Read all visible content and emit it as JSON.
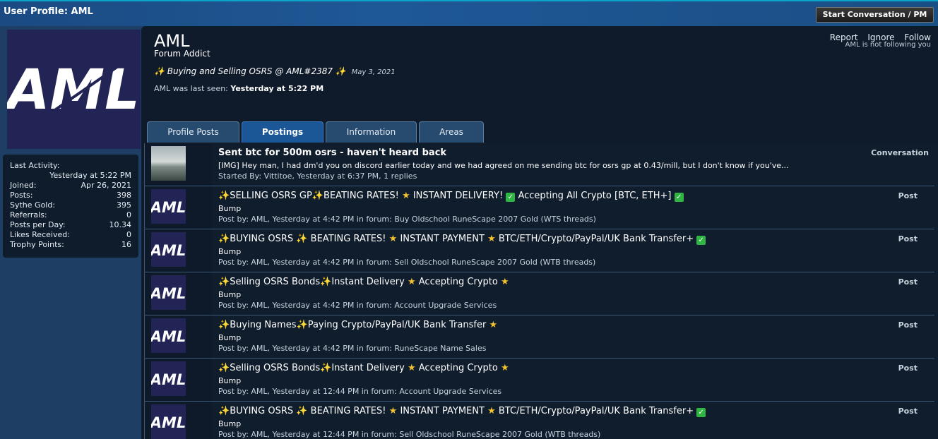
{
  "topbar": {
    "title": "User Profile: AML",
    "start_button": "Start Conversation / PM"
  },
  "avatar": {
    "letters": "AML"
  },
  "stats": [
    {
      "label": "Last Activity:",
      "value": "Yesterday at 5:22 PM",
      "block": true
    },
    {
      "label": "Joined:",
      "value": "Apr 26, 2021"
    },
    {
      "label": "Posts:",
      "value": "398"
    },
    {
      "label": "Sythe Gold:",
      "value": "395"
    },
    {
      "label": "Referrals:",
      "value": "0"
    },
    {
      "label": "Posts per Day:",
      "value": "10.34"
    },
    {
      "label": "Likes Received:",
      "value": "0"
    },
    {
      "label": "Trophy Points:",
      "value": "16"
    }
  ],
  "profile": {
    "name": "AML",
    "title": "Forum Addict",
    "status": "Buying and Selling OSRS @ AML#2387",
    "status_date": "May 3, 2021",
    "last_seen_prefix": "AML was last seen:",
    "last_seen_value": "Yesterday at 5:22 PM"
  },
  "actions": {
    "report": "Report",
    "ignore": "Ignore",
    "follow": "Follow",
    "follow_note": "AML is not following you"
  },
  "tabs": [
    {
      "label": "Profile Posts",
      "active": false
    },
    {
      "label": "Postings",
      "active": true
    },
    {
      "label": "Information",
      "active": false
    },
    {
      "label": "Areas",
      "active": false
    }
  ],
  "icons": {
    "sparkle": "sparkle-icon",
    "star": "star-icon",
    "check": "check-icon"
  },
  "colors": {
    "accent": "#1b5796",
    "star": "#f4c12f",
    "check": "#30b443"
  },
  "items": [
    {
      "kind": "Conversation",
      "thumb": "photo",
      "title": "Sent btc for 500m osrs - haven't heard back",
      "snippet": "[IMG] Hey man, I had dm'd you on discord earlier today and we had agreed on me sending btc for osrs gp at 0.43/mill, but I don't know if you've...",
      "meta": "Started By: Vittitoe, Yesterday at 6:37 PM, 1 replies"
    },
    {
      "kind": "Post",
      "thumb": "avatar",
      "title": "✨SELLING OSRS GP✨BEATING RATES! ⭐ INSTANT DELIVERY! ✅ Accepting All Crypto [BTC, ETH+] ✅",
      "snippet": "Bump",
      "meta": "Post by: AML, Yesterday at 4:42 PM in forum: Buy Oldschool RuneScape 2007 Gold (WTS threads)"
    },
    {
      "kind": "Post",
      "thumb": "avatar",
      "title": "✨BUYING OSRS ✨ BEATING RATES! ⭐ INSTANT PAYMENT ⭐ BTC/ETH/Crypto/PayPal/UK Bank Transfer+ ✅",
      "snippet": "Bump",
      "meta": "Post by: AML, Yesterday at 4:42 PM in forum: Sell Oldschool RuneScape 2007 Gold (WTB threads)"
    },
    {
      "kind": "Post",
      "thumb": "avatar",
      "title": "✨Selling OSRS Bonds✨Instant Delivery ⭐ Accepting Crypto ⭐",
      "snippet": "Bump",
      "meta": "Post by: AML, Yesterday at 4:42 PM in forum: Account Upgrade Services"
    },
    {
      "kind": "Post",
      "thumb": "avatar",
      "title": "✨Buying Names✨Paying Crypto/PayPal/UK Bank Transfer ⭐",
      "snippet": "Bump",
      "meta": "Post by: AML, Yesterday at 4:42 PM in forum: RuneScape Name Sales"
    },
    {
      "kind": "Post",
      "thumb": "avatar",
      "title": "✨Selling OSRS Bonds✨Instant Delivery ⭐ Accepting Crypto ⭐",
      "snippet": "Bump",
      "meta": "Post by: AML, Yesterday at 12:44 PM in forum: Account Upgrade Services"
    },
    {
      "kind": "Post",
      "thumb": "avatar",
      "title": "✨BUYING OSRS ✨ BEATING RATES! ⭐ INSTANT PAYMENT ⭐ BTC/ETH/Crypto/PayPal/UK Bank Transfer+ ✅",
      "snippet": "Bump",
      "meta": "Post by: AML, Yesterday at 12:44 PM in forum: Sell Oldschool RuneScape 2007 Gold (WTB threads)"
    }
  ]
}
